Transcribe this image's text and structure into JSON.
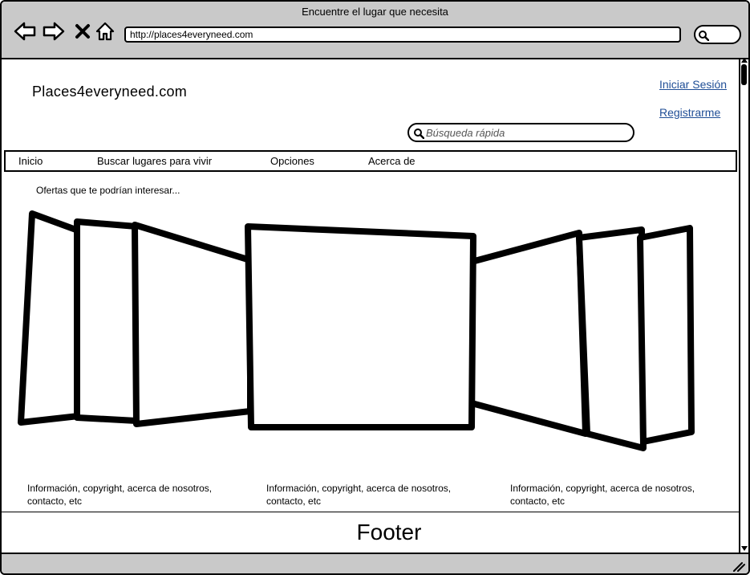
{
  "window": {
    "title": "Encuentre el lugar que necesita",
    "url": "http://places4everyneed.com"
  },
  "header": {
    "logo": "Places4everyneed.com",
    "login_link": "Iniciar Sesión",
    "register_link": "Registrarme",
    "search_placeholder": "Búsqueda rápida"
  },
  "menu": {
    "items": [
      {
        "label": "Inicio"
      },
      {
        "label": "Buscar lugares para vivir"
      },
      {
        "label": "Opciones"
      },
      {
        "label": "Acerca de"
      }
    ]
  },
  "main": {
    "offers_label": "Ofertas que te podrían interesar..."
  },
  "footer": {
    "columns": [
      {
        "text": "Información, copyright, acerca de nosotros, contacto, etc"
      },
      {
        "text": "Información, copyright, acerca de nosotros, contacto, etc"
      },
      {
        "text": "Información, copyright, acerca de nosotros, contacto, etc"
      }
    ],
    "title": "Footer"
  },
  "colors": {
    "chrome": "#c9c9c9",
    "link": "#1f4e96"
  },
  "icons": [
    "back-arrow-icon",
    "forward-arrow-icon",
    "stop-icon",
    "home-icon",
    "search-icon",
    "resize-grip-icon"
  ]
}
